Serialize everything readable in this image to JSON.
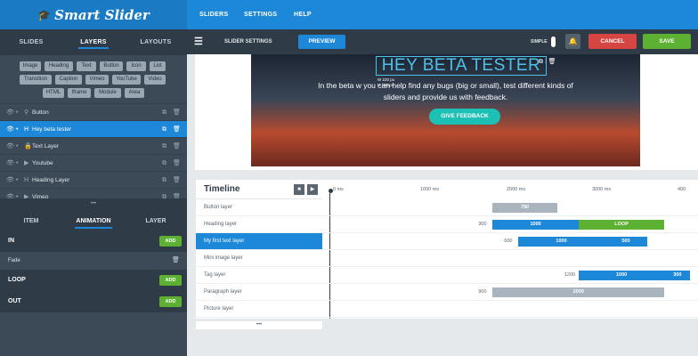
{
  "brand": {
    "logo": "Smart Slider"
  },
  "topnav": {
    "sliders": "SLIDERS",
    "settings": "SETTINGS",
    "help": "HELP"
  },
  "left_tabs": [
    "SLIDES",
    "LAYERS",
    "LAYOUTS"
  ],
  "palette": [
    "Image",
    "Heading",
    "Text",
    "Button",
    "Icon",
    "List",
    "Transition",
    "Caption",
    "Vimeo",
    "YouTube",
    "Video",
    "HTML",
    "Iframe",
    "Module",
    "Area"
  ],
  "layers": [
    {
      "name": "Button",
      "icon": "link-icon"
    },
    {
      "name": "Hey beta tester",
      "icon": "heading-icon"
    },
    {
      "name": "Text Layer",
      "icon": "text-icon"
    },
    {
      "name": "Youtube",
      "icon": "video-icon"
    },
    {
      "name": "Heading Layer",
      "icon": "heading-icon"
    },
    {
      "name": "Vimeo",
      "icon": "video-icon"
    }
  ],
  "panel_tabs": [
    "ITEM",
    "ANIMATION",
    "LAYER"
  ],
  "animation": {
    "in": "IN",
    "fade": "Fade",
    "loop": "LOOP",
    "out": "OUT",
    "add": "ADD"
  },
  "toolbar": {
    "slider_settings": "SLIDER SETTINGS",
    "preview": "PREVIEW",
    "simple": "SIMPLE",
    "cancel": "CANCEL",
    "save": "SAVE"
  },
  "slide": {
    "heading": "HEY BETA TESTER",
    "paragraph": "In the beta w      you can help find any bugs (big or small), test different kinds of sliders and provide us with feedback.",
    "button": "GIVE FEEDBACK",
    "width_label": "W",
    "width": "220 px",
    "height_label": "H",
    "height": "180 px"
  },
  "timeline": {
    "title": "Timeline",
    "ticks": [
      "0 ms",
      "1000 ms",
      "2000 ms",
      "3000 ms",
      "400"
    ],
    "rows": [
      {
        "name": "Button layer",
        "delay": "",
        "bars": [
          {
            "label": "750",
            "kind": "grey",
            "start": 1900,
            "dur": 750
          }
        ]
      },
      {
        "name": "Heading layer",
        "delay": "300",
        "bars": [
          {
            "label": "1000",
            "kind": "blue",
            "start": 1900,
            "dur": 1000
          },
          {
            "label": "LOOP",
            "kind": "green",
            "start": 2900,
            "dur": 1000
          }
        ]
      },
      {
        "name": "My first text layer",
        "delay": "600",
        "bars": [
          {
            "label": "1000",
            "kind": "blue",
            "start": 2200,
            "dur": 1000
          },
          {
            "label": "500",
            "kind": "blue",
            "start": 3200,
            "dur": 500
          }
        ]
      },
      {
        "name": "Mini image layer",
        "delay": "",
        "bars": []
      },
      {
        "name": "Tag layer",
        "delay": "1200",
        "bars": [
          {
            "label": "1000",
            "kind": "blue",
            "start": 2900,
            "dur": 1000
          },
          {
            "label": "300",
            "kind": "blue",
            "start": 3900,
            "dur": 300
          }
        ]
      },
      {
        "name": "Paragraph layer",
        "delay": "900",
        "bars": [
          {
            "label": "2000",
            "kind": "grey",
            "start": 1900,
            "dur": 2000
          }
        ]
      },
      {
        "name": "Picture layer",
        "delay": "",
        "bars": []
      }
    ],
    "more": "•••"
  },
  "colors": {
    "primary": "#1e88d8",
    "danger": "#d64541",
    "success": "#5cb032",
    "panel": "#3c4a58"
  }
}
